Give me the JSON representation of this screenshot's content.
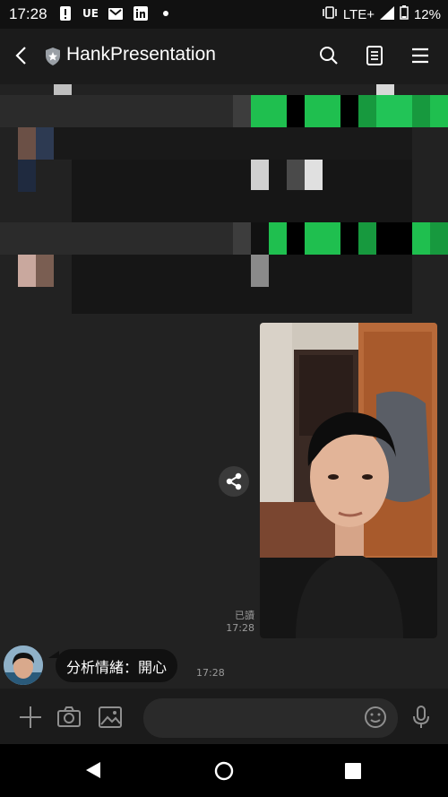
{
  "status_bar": {
    "time": "17:28",
    "notification_icons": [
      "alert-icon",
      "ue-icon",
      "mail-icon",
      "linkedin-icon",
      "dot-icon"
    ],
    "ue_label": "UE",
    "network": "LTE+",
    "battery": "12%"
  },
  "header": {
    "title": "HankPresentation",
    "icons": [
      "back-icon",
      "shield-icon",
      "search-icon",
      "notes-icon",
      "menu-icon"
    ]
  },
  "chat": {
    "read_label": "已讀",
    "image_time": "17:28",
    "incoming_message": "分析情緒：開心",
    "incoming_time": "17:28"
  },
  "input_bar": {
    "placeholder": "",
    "icons": [
      "plus-icon",
      "camera-icon",
      "gallery-icon",
      "emoji-icon",
      "mic-icon"
    ]
  },
  "colors": {
    "background": "#222222",
    "bubble": "#111111",
    "line_green": "#1fbf4f"
  }
}
